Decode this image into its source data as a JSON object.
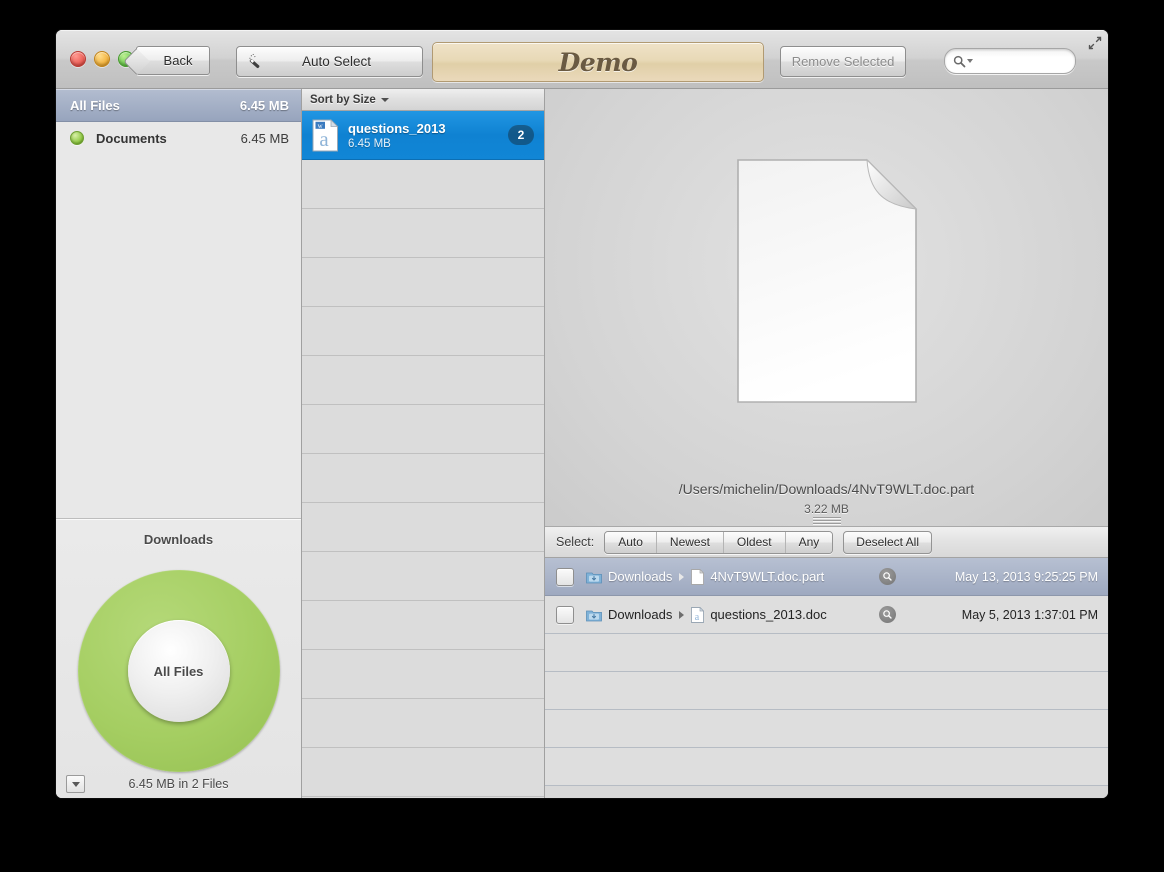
{
  "window": {
    "title": "Demo",
    "traffic_lights": [
      "close",
      "minimize",
      "maximize"
    ]
  },
  "toolbar": {
    "back_label": "Back",
    "auto_select_label": "Auto Select",
    "banner_label": "Demo",
    "remove_selected_label": "Remove Selected",
    "search_placeholder": "",
    "search_value": "",
    "icons": {
      "wand": "magic-wand-icon",
      "search": "search-icon",
      "fullscreen": "fullscreen-icon"
    }
  },
  "sidebar": {
    "header": {
      "name": "All Files",
      "size": "6.45 MB"
    },
    "items": [
      {
        "name": "Documents",
        "size": "6.45 MB",
        "dot_color": "#8cc63f"
      }
    ],
    "chart": {
      "title": "Downloads",
      "center_label": "All Files",
      "footer": "6.45 MB in 2 Files",
      "ring_color": "#a5ce62",
      "menu_icon": "chevron-down-icon"
    }
  },
  "file_column": {
    "sort_label": "Sort by Size",
    "rows": [
      {
        "name": "questions_2013",
        "size": "6.45 MB",
        "badge": "2",
        "selected": true
      }
    ],
    "empty_row_count": 13
  },
  "preview": {
    "path": "/Users/michelin/Downloads/4NvT9WLT.doc.part",
    "size": "3.22 MB",
    "icon": "blank-document-icon"
  },
  "select_bar": {
    "label": "Select:",
    "segments": [
      "Auto",
      "Newest",
      "Oldest",
      "Any"
    ],
    "deselect_all_label": "Deselect All"
  },
  "duplicates": {
    "rows": [
      {
        "checked": false,
        "folder": "Downloads",
        "file": "4NvT9WLT.doc.part",
        "date": "May 13, 2013 9:25:25 PM",
        "selected": true
      },
      {
        "checked": false,
        "folder": "Downloads",
        "file": "questions_2013.doc",
        "date": "May 5, 2013 1:37:01 PM",
        "selected": false
      }
    ],
    "empty_row_count": 4
  }
}
